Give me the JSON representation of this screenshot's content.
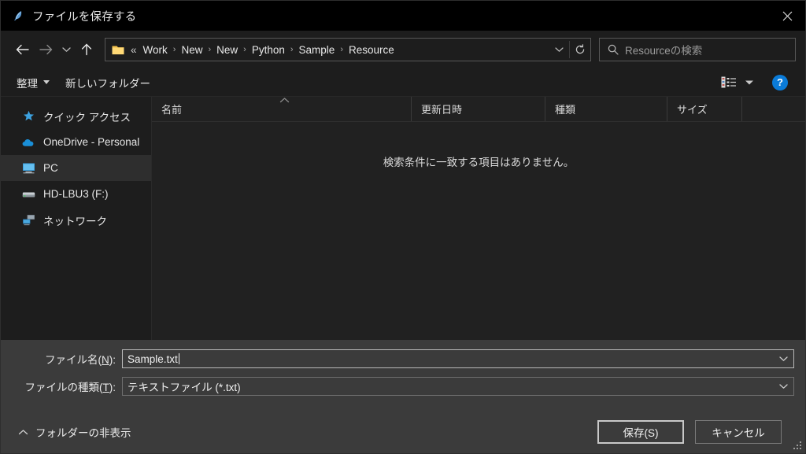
{
  "window": {
    "title": "ファイルを保存する",
    "title_icon": "feather-icon",
    "close_label": "✕"
  },
  "nav": {
    "back_icon": "arrow-left-icon",
    "forward_icon": "arrow-right-icon",
    "recent_icon": "chevron-down-icon",
    "up_icon": "arrow-up-icon",
    "address": {
      "folder_icon": "folder-icon",
      "prefix": "«",
      "crumbs": [
        "Work",
        "New",
        "New",
        "Python",
        "Sample",
        "Resource"
      ],
      "separator": "›",
      "dropdown_icon": "chevron-down-icon",
      "refresh_icon": "refresh-icon"
    },
    "search": {
      "icon": "search-icon",
      "placeholder": "Resourceの検索",
      "value": ""
    }
  },
  "commandbar": {
    "organize_label": "整理",
    "new_folder_label": "新しいフォルダー",
    "view_icon": "list-view-icon",
    "view_dropdown_icon": "chevron-down-icon",
    "help_label": "?"
  },
  "sidebar": {
    "items": [
      {
        "label": "クイック アクセス",
        "icon": "star-icon",
        "selected": false
      },
      {
        "label": "OneDrive - Personal",
        "icon": "cloud-icon",
        "selected": false
      },
      {
        "label": "PC",
        "icon": "monitor-icon",
        "selected": true
      },
      {
        "label": "HD-LBU3 (F:)",
        "icon": "drive-icon",
        "selected": false
      },
      {
        "label": "ネットワーク",
        "icon": "network-icon",
        "selected": false
      }
    ]
  },
  "filelist": {
    "columns": [
      {
        "label": "名前",
        "sorted": "ascending"
      },
      {
        "label": "更新日時",
        "sorted": ""
      },
      {
        "label": "種類",
        "sorted": ""
      },
      {
        "label": "サイズ",
        "sorted": ""
      }
    ],
    "sort_caret": "︿",
    "empty_message": "検索条件に一致する項目はありません。",
    "rows": []
  },
  "form": {
    "filename": {
      "label_pre": "ファイル名(",
      "label_key": "N",
      "label_post": "):",
      "value": "Sample.txt",
      "focused": true,
      "dropdown_icon": "chevron-down-icon"
    },
    "filetype": {
      "label_pre": "ファイルの種類(",
      "label_key": "T",
      "label_post": "):",
      "value": "テキストファイル (*.txt)",
      "focused": false,
      "dropdown_icon": "chevron-down-icon"
    }
  },
  "actions": {
    "folder_toggle_label": "フォルダーの非表示",
    "folder_toggle_icon": "chevron-up-icon",
    "save_label": "保存(S)",
    "cancel_label": "キャンセル"
  },
  "colors": {
    "window_bg": "#1d1d1d",
    "titlebar_bg": "#000000",
    "pane_bg": "#212121",
    "bottom_bg": "#3b3b3b",
    "selection_bg": "#2e2e2e",
    "accent_blue": "#0a7bd8",
    "folder_yellow": "#f2c14b",
    "text": "#e8e8e8"
  }
}
